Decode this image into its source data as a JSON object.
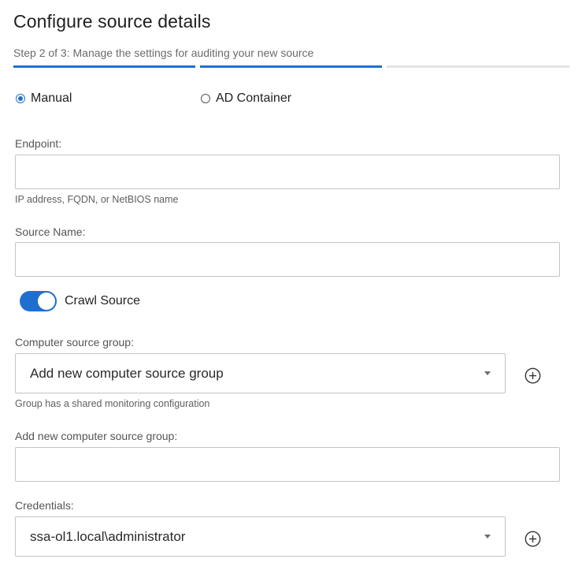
{
  "page": {
    "title": "Configure source details",
    "subtitle": "Step 2 of 3: Manage the settings for auditing your new source"
  },
  "steps": {
    "active_color": "#1f6fd1",
    "inactive_color": "#e3e3e3",
    "states": [
      "complete",
      "current",
      "pending"
    ]
  },
  "mode": {
    "options": [
      {
        "label": "Manual",
        "selected": true
      },
      {
        "label": "AD Container",
        "selected": false
      }
    ]
  },
  "endpoint": {
    "label": "Endpoint:",
    "value": "",
    "hint": "IP address, FQDN, or NetBIOS name"
  },
  "source_name": {
    "label": "Source Name:",
    "value": ""
  },
  "crawl": {
    "label": "Crawl Source",
    "enabled": true
  },
  "computer_group": {
    "label": "Computer source group:",
    "selected": "Add new computer source group",
    "hint": "Group has a shared monitoring configuration",
    "add_icon": "plus-circle-icon"
  },
  "new_group": {
    "label": "Add new computer source group:",
    "value": ""
  },
  "credentials": {
    "label": "Credentials:",
    "selected": "ssa-ol1.local\\administrator",
    "add_icon": "plus-circle-icon"
  }
}
